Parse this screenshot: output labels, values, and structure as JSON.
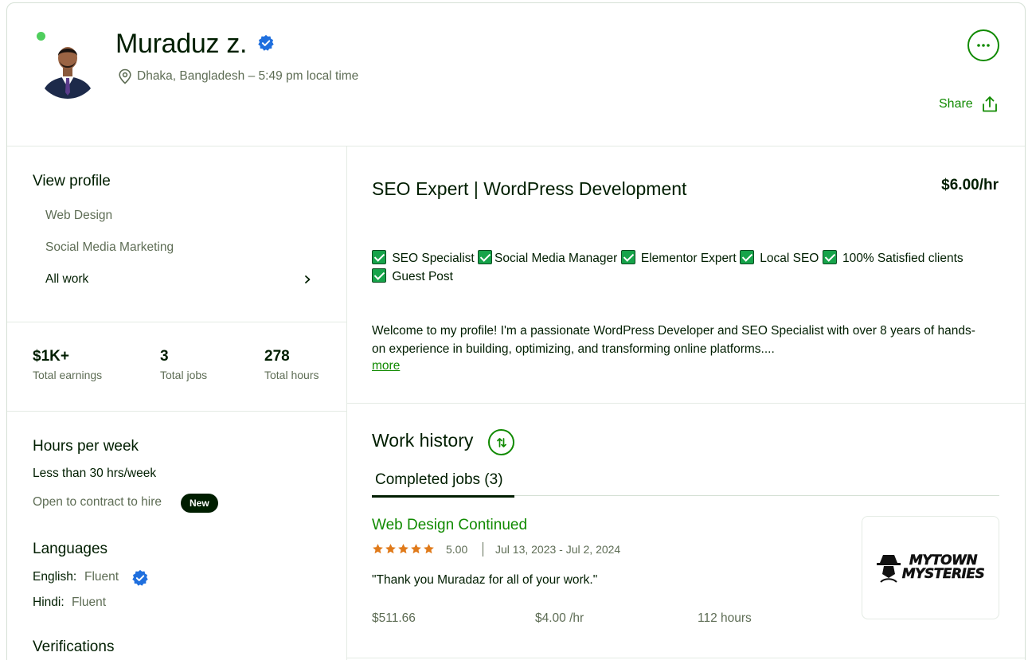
{
  "profile": {
    "name": "Muraduz z.",
    "location": "Dhaka, Bangladesh – 5:49 pm local time",
    "share_label": "Share"
  },
  "sidebar": {
    "view_profile_title": "View profile",
    "links": [
      {
        "label": "Web Design"
      },
      {
        "label": "Social Media Marketing"
      },
      {
        "label": "All work"
      }
    ]
  },
  "stats": [
    {
      "value": "$1K+",
      "label": "Total earnings"
    },
    {
      "value": "3",
      "label": "Total jobs"
    },
    {
      "value": "278",
      "label": "Total hours"
    }
  ],
  "hours": {
    "title": "Hours per week",
    "value": "Less than 30 hrs/week",
    "contract": "Open to contract to hire",
    "badge": "New"
  },
  "languages": {
    "title": "Languages",
    "items": [
      {
        "name": "English:",
        "level": "Fluent"
      },
      {
        "name": "Hindi:",
        "level": "Fluent"
      }
    ]
  },
  "verifications": {
    "title": "Verifications"
  },
  "headline": {
    "title": "SEO Expert | WordPress Development",
    "rate": "$6.00/hr",
    "bullets": [
      "SEO Specialist",
      "Social Media Manager",
      "Elementor Expert",
      "Local SEO",
      "100% Satisfied clients",
      "Guest Post"
    ],
    "overview_line1": "Welcome to my profile! I'm a passionate WordPress Developer and SEO Specialist with over 8 years of hands-",
    "overview_line2": "on experience in building, optimizing, and transforming online platforms....",
    "more_label": "more"
  },
  "work_history": {
    "title": "Work history",
    "tab_label": "Completed jobs (3)",
    "jobs": [
      {
        "title": "Web Design Continued",
        "rating": "5.00",
        "stars": 5,
        "dates": "Jul 13, 2023 - Jul 2, 2024",
        "feedback": "\"Thank you Muradaz for all of your work.\"",
        "earned": "$511.66",
        "rate": "$4.00 /hr",
        "hours": "112 hours",
        "client_logo_text": [
          "MYTOWN",
          "MYSTERIES"
        ]
      }
    ]
  },
  "colors": {
    "brand_green": "#108a00",
    "online_dot": "#4fce5d",
    "verified_blue": "#1f6fde",
    "star_orange": "#e07a1a",
    "text_dark": "#001e00",
    "text_muted": "#5e6d55"
  }
}
